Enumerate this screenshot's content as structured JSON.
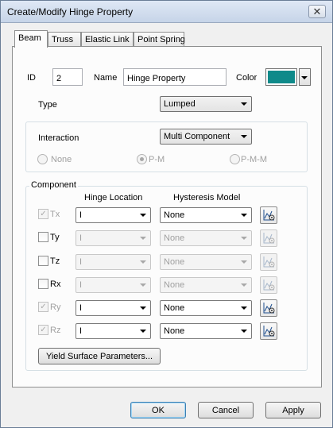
{
  "window": {
    "title": "Create/Modify Hinge Property",
    "close_glyph": "✕"
  },
  "tabs": [
    "Beam",
    "Truss",
    "Elastic Link",
    "Point Spring"
  ],
  "form": {
    "id_label": "ID",
    "id_value": "2",
    "name_label": "Name",
    "name_value": "Hinge Property",
    "color_label": "Color",
    "color_value": "#0f8a8a",
    "type_label": "Type",
    "type_value": "Lumped"
  },
  "interaction": {
    "label": "Interaction",
    "value": "Multi Component",
    "options": [
      {
        "label": "None",
        "selected": false
      },
      {
        "label": "P-M",
        "selected": true
      },
      {
        "label": "P-M-M",
        "selected": false
      }
    ]
  },
  "component": {
    "group_title": "Component",
    "header_location": "Hinge Location",
    "header_model": "Hysteresis Model",
    "rows": [
      {
        "label": "Tx",
        "checked": true,
        "checkbox_disabled": true,
        "location": "I",
        "model": "None",
        "enabled": true
      },
      {
        "label": "Ty",
        "checked": false,
        "checkbox_disabled": false,
        "location": "I",
        "model": "None",
        "enabled": false
      },
      {
        "label": "Tz",
        "checked": false,
        "checkbox_disabled": false,
        "location": "I",
        "model": "None",
        "enabled": false
      },
      {
        "label": "Rx",
        "checked": false,
        "checkbox_disabled": false,
        "location": "I",
        "model": "None",
        "enabled": false
      },
      {
        "label": "Ry",
        "checked": true,
        "checkbox_disabled": true,
        "location": "I",
        "model": "None",
        "enabled": true
      },
      {
        "label": "Rz",
        "checked": true,
        "checkbox_disabled": true,
        "location": "I",
        "model": "None",
        "enabled": true
      }
    ],
    "yield_button": "Yield Surface Parameters..."
  },
  "buttons": {
    "ok": "OK",
    "cancel": "Cancel",
    "apply": "Apply"
  }
}
